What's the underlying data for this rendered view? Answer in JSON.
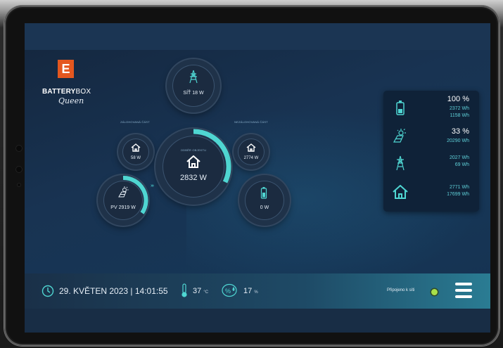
{
  "brand": {
    "logo_letter": "E",
    "name_bold": "BATTERY",
    "name_thin": "BOX",
    "subtitle": "Queen",
    "accent": "#e4571f"
  },
  "nodes": {
    "grid": {
      "label": "SÍŤ 18 W",
      "icon": "pylon-icon"
    },
    "backup_part": {
      "caption": "ZÁLOHOVANÁ ČÁST",
      "label": "58 W",
      "icon": "house-icon"
    },
    "house": {
      "caption": "ODBĚR OBJEKTU",
      "label": "2832 W",
      "icon": "house-icon"
    },
    "non_backup_part": {
      "caption": "NEZÁLOHOVANÁ ČÁST",
      "label": "2774 W",
      "icon": "house-icon"
    },
    "pv": {
      "label": "PV 2919 W",
      "icon": "solar-panel-icon"
    },
    "battery": {
      "label": "0 W",
      "icon": "battery-icon"
    }
  },
  "stats": {
    "battery": {
      "percent": "100 %",
      "line1": "2372 Wh",
      "line2": "1158 Wh"
    },
    "solar": {
      "percent": "33 %",
      "line1": "20290 Wh"
    },
    "grid": {
      "line1": "2027 Wh",
      "line2": "69 Wh"
    },
    "home": {
      "line1": "2771 Wh",
      "line2": "17699 Wh"
    }
  },
  "footer": {
    "datetime": "29. KVĚTEN 2023 | 14:01:55",
    "temperature": "37",
    "temperature_unit": "°C",
    "humidity": "17",
    "humidity_unit": "%",
    "connection_label": "Připojeno k síti"
  },
  "colors": {
    "accent": "#4fd6d2",
    "connected": "#a8e04a"
  }
}
